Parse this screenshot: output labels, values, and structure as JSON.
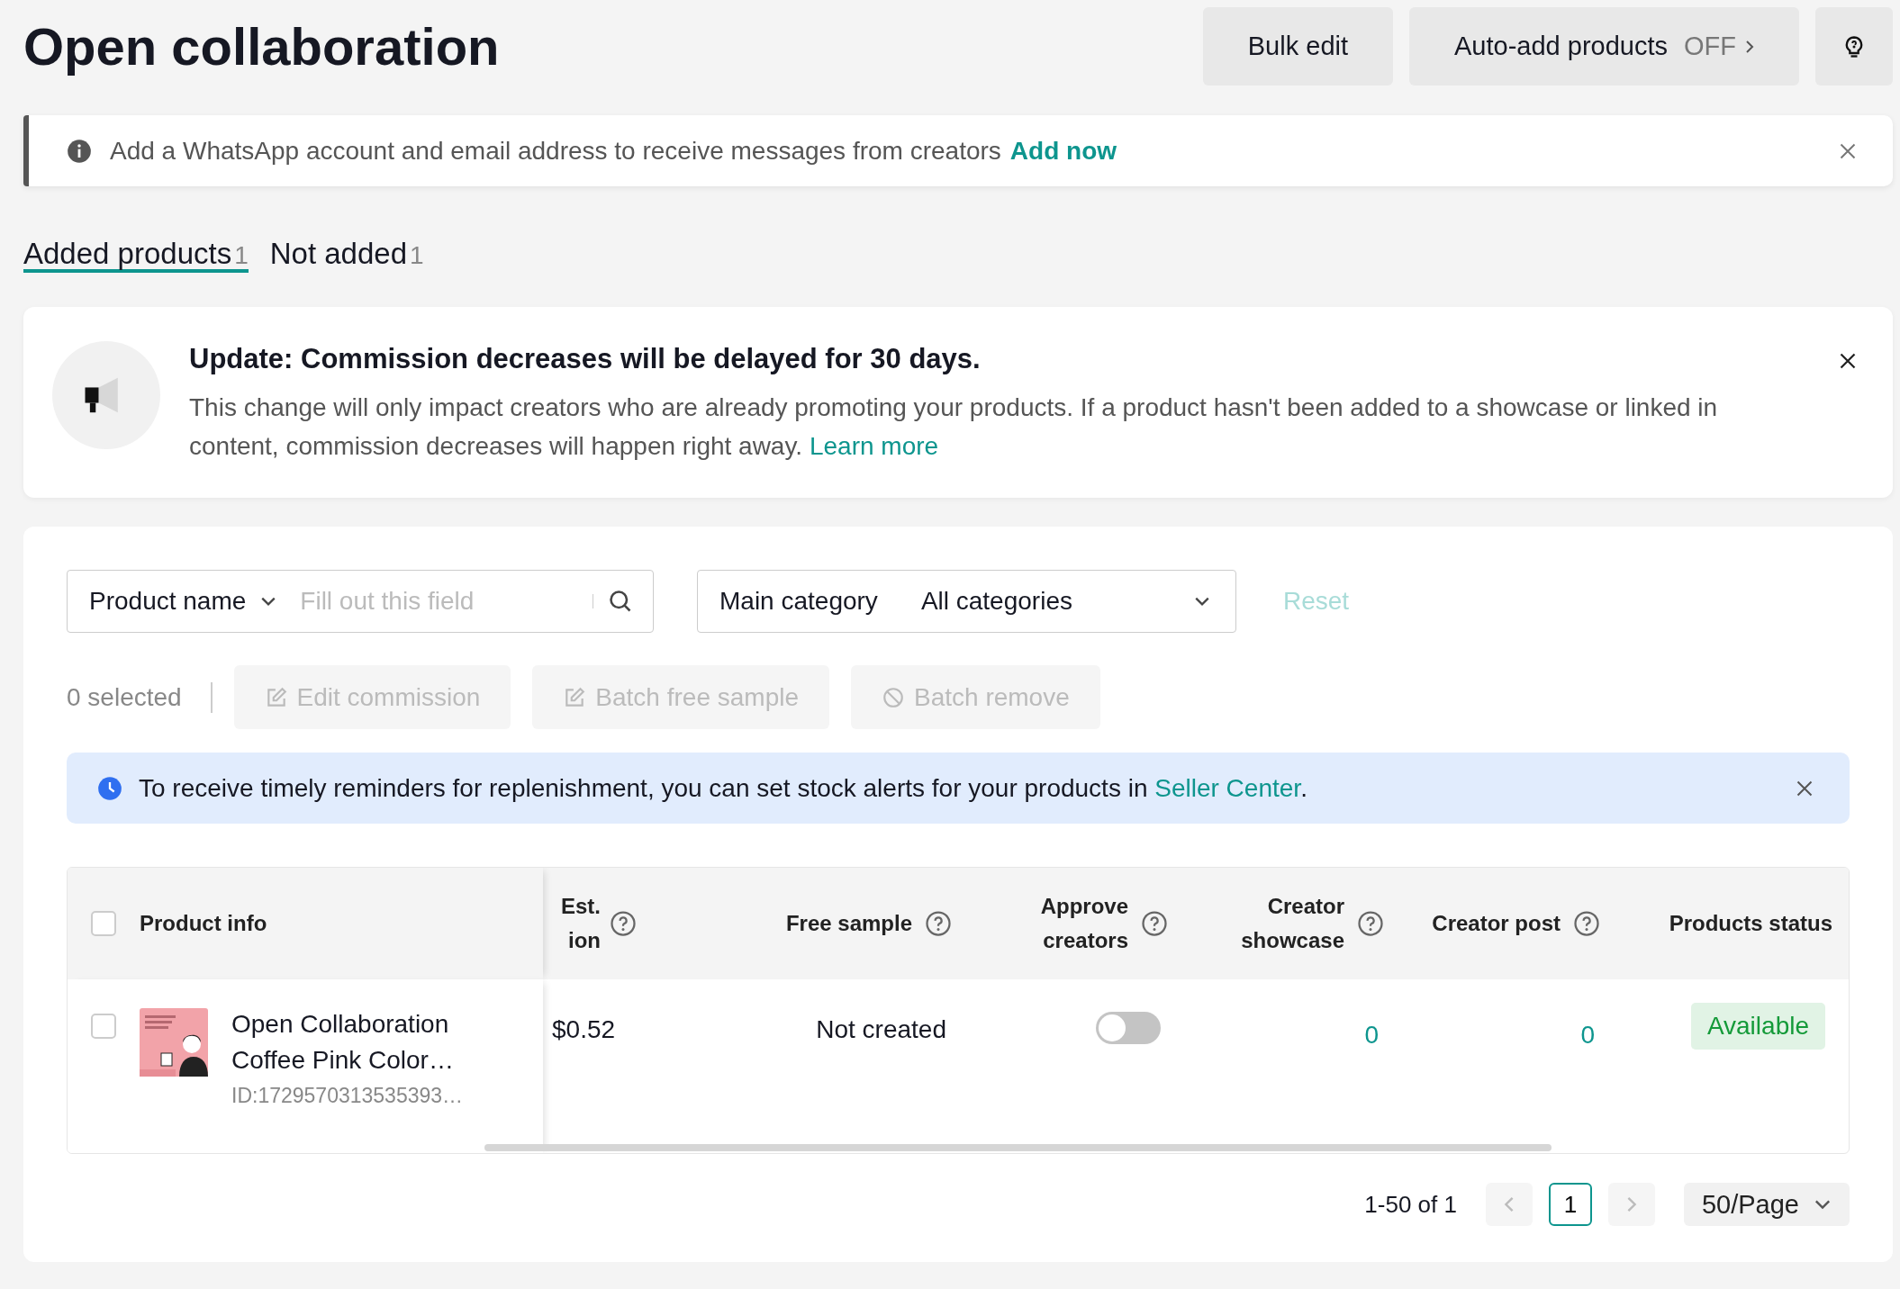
{
  "page_title": "Open collaboration",
  "bulk_edit": "Bulk edit",
  "auto_add": {
    "label": "Auto-add products",
    "state": "OFF"
  },
  "notice": {
    "text": "Add a WhatsApp account and email address to receive messages from creators",
    "link": "Add now"
  },
  "tabs": [
    {
      "label": "Added products",
      "count": "1",
      "selected": true
    },
    {
      "label": "Not added",
      "count": "1",
      "selected": false
    }
  ],
  "update_card": {
    "title": "Update: Commission decreases will be delayed for 30 days.",
    "body": "This change will only impact creators who are already promoting your products. If a product hasn't been added to a showcase or linked in content, commission decreases will happen right away.",
    "link": "Learn more"
  },
  "filters": {
    "field_type": "Product name",
    "placeholder": "Fill out this field",
    "category_label": "Main category",
    "category_value": "All categories",
    "reset": "Reset"
  },
  "batch": {
    "selected_text": "0 selected",
    "actions": [
      {
        "label": "Edit commission",
        "kind": "edit",
        "disabled": true
      },
      {
        "label": "Batch free sample",
        "kind": "edit",
        "disabled": true
      },
      {
        "label": "Batch remove",
        "kind": "remove",
        "disabled": true
      }
    ]
  },
  "alert": {
    "text": "To receive timely reminders for replenishment, you can set stock alerts for your products in",
    "link": "Seller Center",
    "end": "."
  },
  "table": {
    "select_all": {
      "checked": false
    },
    "first_column": "Product info",
    "columns": [
      {
        "lines": [
          "Est.",
          "ion"
        ],
        "help": true
      },
      {
        "lines": [
          "Free sample"
        ],
        "help": true
      },
      {
        "lines": [
          "Approve",
          "creators"
        ],
        "help": true
      },
      {
        "lines": [
          "Creator",
          "showcase"
        ],
        "help": true
      },
      {
        "lines": [
          "Creator post"
        ],
        "help": true
      },
      {
        "lines": [
          "Products status"
        ],
        "help": false
      }
    ],
    "rows": [
      {
        "checked": false,
        "name_lines": [
          "Open Collaboration",
          "Coffee Pink Color…"
        ],
        "id": "ID:1729570313535393…",
        "cells": [
          {
            "kind": "text",
            "value": "$0.52"
          },
          {
            "kind": "text",
            "value": "Not created"
          },
          {
            "kind": "toggle",
            "on": false
          },
          {
            "kind": "link",
            "value": "0"
          },
          {
            "kind": "link",
            "value": "0"
          },
          {
            "kind": "badge",
            "value": "Available"
          }
        ]
      }
    ]
  },
  "pagination": {
    "range": "1-50 of 1",
    "pages": [
      {
        "label": "1",
        "selected": true
      }
    ],
    "page_size": "50/Page"
  }
}
